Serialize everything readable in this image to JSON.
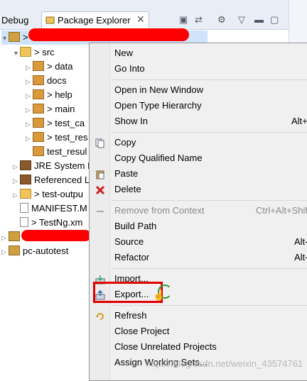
{
  "tabs": {
    "debug": "Debug",
    "package_explorer": "Package Explorer"
  },
  "tree": {
    "src": "> src",
    "data": "> data",
    "docs": "docs",
    "help": "> help",
    "main": "> main",
    "test_ca": "> test_ca",
    "test_res": "> test_res",
    "test_resul": "test_resul",
    "jre": "JRE System L",
    "referenced": "Referenced L",
    "test_output": "> test-outpu",
    "manifest": "MANIFEST.M",
    "testng": "> TestNg.xm",
    "pc_autotest": "pc-autotest"
  },
  "menu": {
    "new": "New",
    "go_into": "Go Into",
    "open_new_window": "Open in New Window",
    "open_type_hierarchy": "Open Type Hierarchy",
    "show_in": "Show In",
    "show_in_sc": "Alt+",
    "copy": "Copy",
    "copy_qualified": "Copy Qualified Name",
    "paste": "Paste",
    "delete": "Delete",
    "remove_context": "Remove from Context",
    "remove_context_sc": "Ctrl+Alt+Shif",
    "build_path": "Build Path",
    "source": "Source",
    "source_sc": "Alt-",
    "refactor": "Refactor",
    "refactor_sc": "Alt-",
    "import": "Import...",
    "export": "Export...",
    "refresh": "Refresh",
    "close_project": "Close Project",
    "close_unrelated": "Close Unrelated Projects",
    "assign_working_sets": "Assign Working Sets..."
  },
  "watermark": "https://blog.csdn.net/weixin_43574761"
}
